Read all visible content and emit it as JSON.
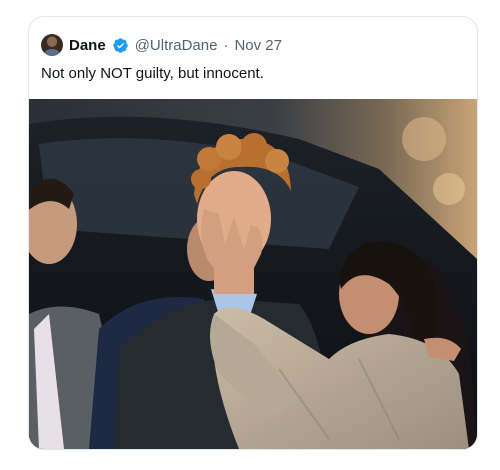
{
  "tweet": {
    "author_name": "Dane",
    "handle": "@UltraDane",
    "separator": "·",
    "date": "Nov 27",
    "text": "Not only NOT guilty, but innocent.",
    "icons": {
      "avatar": "user-avatar",
      "verified": "verified-badge-icon"
    },
    "image": {
      "alt_subject": "photo-attachment"
    }
  },
  "colors": {
    "verified_blue": "#1d9bf0",
    "text_primary": "#0f1419",
    "text_secondary": "#536471",
    "border": "#e1e8ed"
  }
}
